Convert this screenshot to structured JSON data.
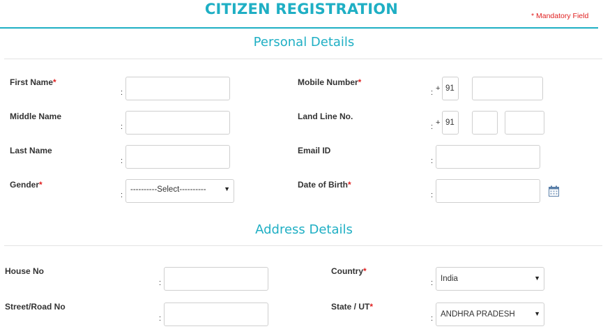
{
  "header": {
    "title": "CITIZEN REGISTRATION",
    "mandatory_note": "* Mandatory Field"
  },
  "personal": {
    "section_title": "Personal Details",
    "first_name": {
      "label": "First Name",
      "required": "*",
      "value": ""
    },
    "middle_name": {
      "label": "Middle Name",
      "value": ""
    },
    "last_name": {
      "label": "Last Name",
      "value": ""
    },
    "gender": {
      "label": "Gender",
      "required": "*",
      "selected": "----------Select----------"
    },
    "mobile": {
      "label": "Mobile Number",
      "required": "*",
      "plus": "+",
      "country_code": "91",
      "value": ""
    },
    "landline": {
      "label": "Land Line No.",
      "plus": "+",
      "country_code": "91",
      "area_code": "",
      "value": ""
    },
    "email": {
      "label": "Email ID",
      "value": ""
    },
    "dob": {
      "label": "Date of Birth",
      "required": "*",
      "value": "",
      "icon": "calendar-icon"
    }
  },
  "address": {
    "section_title": "Address Details",
    "house_no": {
      "label": "House No",
      "value": ""
    },
    "street": {
      "label": "Street/Road No",
      "value": ""
    },
    "country": {
      "label": "Country",
      "required": "*",
      "selected": "India"
    },
    "state": {
      "label": "State / UT",
      "required": "*",
      "selected": "ANDHRA PRADESH"
    }
  },
  "ui": {
    "colon": ":",
    "dropdown_arrow": "▼"
  },
  "colors": {
    "accent": "#1fafc4",
    "required": "#e02020",
    "border": "#cfcfcf"
  }
}
